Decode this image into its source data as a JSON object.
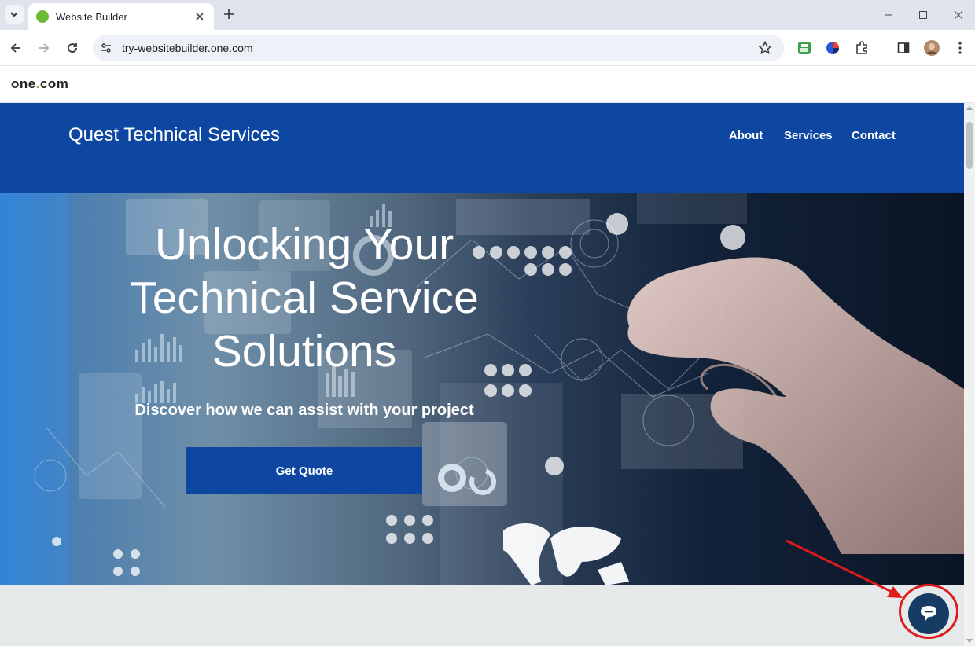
{
  "browser": {
    "tab_title": "Website Builder",
    "url": "try-websitebuilder.one.com"
  },
  "onecom": {
    "logo_before": "one",
    "logo_dot": ".",
    "logo_after": "com"
  },
  "site": {
    "title": "Quest Technical Services",
    "nav": [
      "About",
      "Services",
      "Contact"
    ],
    "hero": {
      "heading_line1": "Unlocking Your",
      "heading_line2": "Technical Service",
      "heading_line3": "Solutions",
      "subheading": "Discover how we can assist with your project",
      "cta_label": "Get Quote"
    }
  },
  "icons": [
    "tab-list-icon",
    "favicon-icon",
    "close-icon",
    "plus-icon",
    "minimize-icon",
    "maximize-icon",
    "back-icon",
    "forward-icon",
    "reload-icon",
    "site-info-icon",
    "star-icon",
    "printer-extension-icon",
    "color-extension-icon",
    "puzzle-icon",
    "side-panel-icon",
    "profile-avatar",
    "more-icon",
    "chat-icon"
  ],
  "colors": {
    "brand_blue": "#0d47a1",
    "onecom_green": "#6dbb35",
    "chat_button": "#163c63",
    "annotation_red": "#e01b1b"
  }
}
